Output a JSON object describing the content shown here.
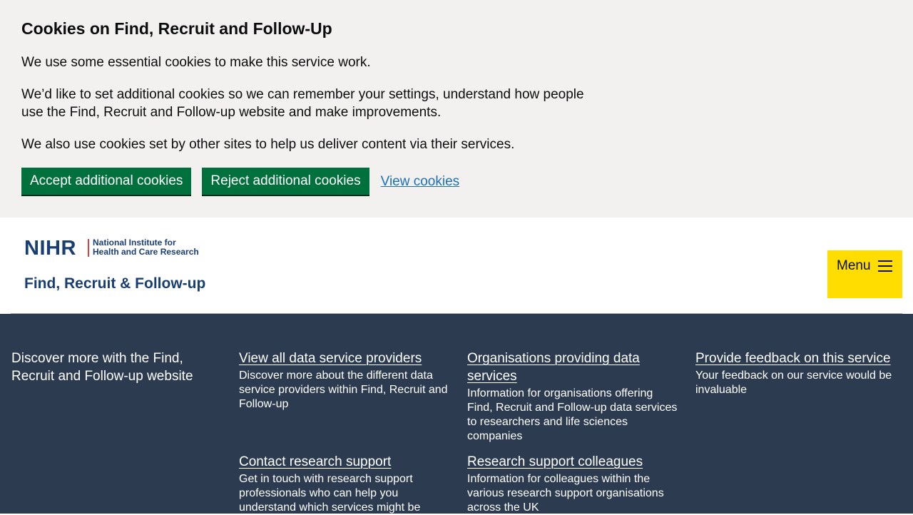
{
  "cookie_banner": {
    "title": "Cookies on Find, Recruit and Follow-Up",
    "paragraph_1": "We use some essential cookies to make this service work.",
    "paragraph_2": "We’d like to set additional cookies so we can remember your settings, understand how people use the Find, Recruit and Follow-up website and make improvements.",
    "paragraph_3": "We also use cookies set by other sites to help us deliver content via their services.",
    "accept_label": "Accept additional cookies",
    "reject_label": "Reject additional cookies",
    "view_label": "View cookies"
  },
  "header": {
    "logo_nihr": "NIHR",
    "logo_org_line1": "National Institute for",
    "logo_org_line2": "Health and Care Research",
    "service_name": "Find, Recruit & Follow-up",
    "menu_label": "Menu",
    "menu_icon": "hamburger-icon"
  },
  "discover": {
    "intro": "Discover more with the Find, Recruit and Follow-up website",
    "cards": [
      {
        "title": "View all data service providers",
        "description": "Discover more about the different data service providers within Find, Recruit and Follow-up"
      },
      {
        "title": "Organisations providing data services",
        "description": "Information for organisations offering Find, Recruit and Follow-up data services to researchers and life sciences companies"
      },
      {
        "title": "Provide feedback on this service",
        "description": "Your feedback on our service would be invaluable"
      },
      {
        "title": "Contact research support",
        "description": "Get in touch with research support professionals who can help you understand which services might be"
      },
      {
        "title": "Research support colleagues",
        "description": "Information for colleagues within the various research support organisations across the UK"
      }
    ]
  },
  "colors": {
    "banner_bg": "#f2f1ef",
    "button_green": "#00703c",
    "link_blue": "#1d70b8",
    "brand_navy": "#193e72",
    "menu_yellow": "#ffdd00",
    "footer_bg": "#2c3b50"
  }
}
